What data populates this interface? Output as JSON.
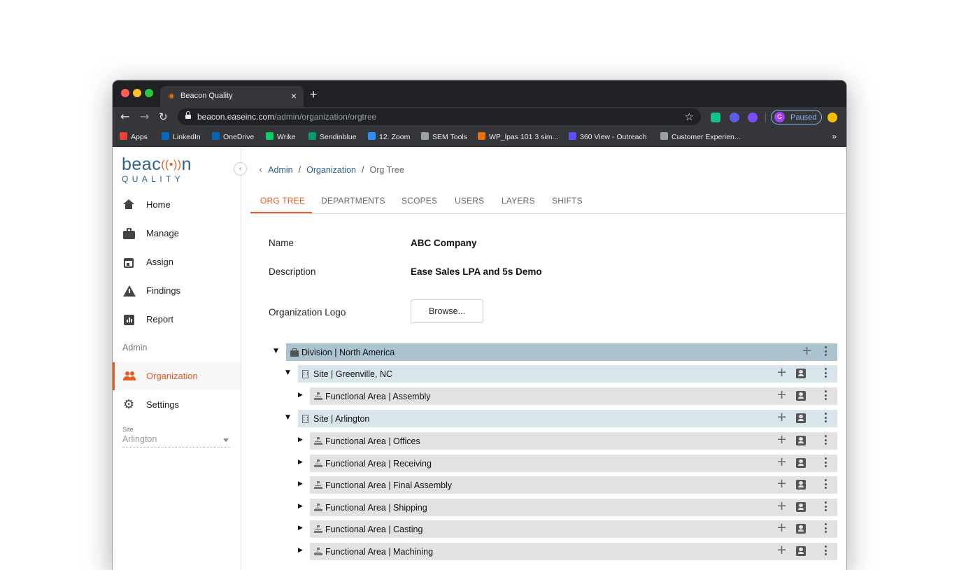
{
  "browser": {
    "tab_title": "Beacon Quality",
    "tab_close": "×",
    "new_tab": "+",
    "url_host": "beacon.easeinc.com",
    "url_path": "/admin/organization/orgtree",
    "profile_initial": "G",
    "profile_label": "Paused",
    "bookmarks": [
      {
        "label": "Apps",
        "color": "#ea4335"
      },
      {
        "label": "LinkedIn",
        "color": "#0a66c2"
      },
      {
        "label": "OneDrive",
        "color": "#0364b8"
      },
      {
        "label": "Wrike",
        "color": "#08cf65"
      },
      {
        "label": "Sendinblue",
        "color": "#0b996e"
      },
      {
        "label": "12. Zoom",
        "color": "#2d8cff"
      },
      {
        "label": "SEM Tools",
        "color": "#9aa0a6"
      },
      {
        "label": "WP_lpas 101 3 sim...",
        "color": "#e8710a"
      },
      {
        "label": "360 View - Outreach",
        "color": "#5951ff"
      },
      {
        "label": "Customer Experien...",
        "color": "#9aa0a6"
      }
    ],
    "bookmarks_more": "»"
  },
  "logo": {
    "text_left": "beac",
    "wave": "((•))",
    "text_right": "n",
    "sub": "QUALITY"
  },
  "sidebar": {
    "items": [
      {
        "label": "Home"
      },
      {
        "label": "Manage"
      },
      {
        "label": "Assign"
      },
      {
        "label": "Findings"
      },
      {
        "label": "Report"
      }
    ],
    "admin_section": "Admin",
    "admin_items": [
      {
        "label": "Organization",
        "active": true
      },
      {
        "label": "Settings"
      }
    ],
    "site": {
      "caption": "Site",
      "value": "Arlington"
    }
  },
  "breadcrumb": {
    "items": [
      "Admin",
      "Organization"
    ],
    "current": "Org Tree",
    "sep": "/"
  },
  "tabs": [
    "ORG TREE",
    "DEPARTMENTS",
    "SCOPES",
    "USERS",
    "LAYERS",
    "SHIFTS"
  ],
  "active_tab": "ORG TREE",
  "org": {
    "name_label": "Name",
    "name_value": "ABC Company",
    "description_label": "Description",
    "description_value": "Ease Sales LPA and 5s Demo",
    "logo_label": "Organization Logo",
    "browse_label": "Browse..."
  },
  "tree": [
    {
      "level": 0,
      "label": "Division | North America",
      "expanded": true,
      "icon": "briefcase-icon",
      "color": "#aac3cf"
    },
    {
      "level": 1,
      "label": "Site | Greenville, NC",
      "expanded": true,
      "icon": "building-icon",
      "color": "#d8e6ec"
    },
    {
      "level": 2,
      "label": "Functional Area | Assembly",
      "expanded": false,
      "icon": "hierarchy-icon",
      "color": "#e2e2e2"
    },
    {
      "level": 1,
      "label": "Site | Arlington",
      "expanded": true,
      "icon": "building-icon",
      "color": "#d8e6ec"
    },
    {
      "level": 2,
      "label": "Functional Area | Offices",
      "expanded": false,
      "icon": "hierarchy-icon",
      "color": "#e2e2e2"
    },
    {
      "level": 2,
      "label": "Functional Area | Receiving",
      "expanded": false,
      "icon": "hierarchy-icon",
      "color": "#e2e2e2"
    },
    {
      "level": 2,
      "label": "Functional Area | Final Assembly",
      "expanded": false,
      "icon": "hierarchy-icon",
      "color": "#e2e2e2"
    },
    {
      "level": 2,
      "label": "Functional Area | Shipping",
      "expanded": false,
      "icon": "hierarchy-icon",
      "color": "#e2e2e2"
    },
    {
      "level": 2,
      "label": "Functional Area | Casting",
      "expanded": false,
      "icon": "hierarchy-icon",
      "color": "#e2e2e2"
    },
    {
      "level": 2,
      "label": "Functional Area | Machining",
      "expanded": false,
      "icon": "hierarchy-icon",
      "color": "#e2e2e2"
    }
  ],
  "colors": {
    "accent": "#e85d25",
    "brand": "#34618a",
    "link": "#2a5c8a"
  }
}
